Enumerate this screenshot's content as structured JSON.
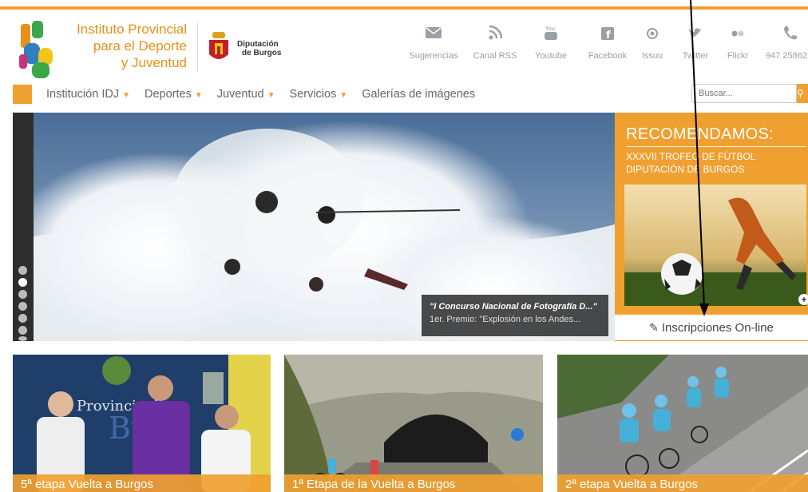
{
  "colors": {
    "accent": "#f0a030",
    "nav_text": "#666666",
    "social_icon": "#9aa0a8"
  },
  "header": {
    "idj_logo_lines": [
      "Instituto Provincial",
      "para el Deporte",
      "y Juventud"
    ],
    "diputacion_lines": [
      "Diputación",
      "de Burgos"
    ]
  },
  "social": [
    {
      "icon": "mail-icon",
      "label": "Sugerencias"
    },
    {
      "icon": "rss-icon",
      "label": "Canal RSS"
    },
    {
      "icon": "youtube-icon",
      "label": "Youtube"
    },
    {
      "icon": "facebook-icon",
      "label": "Facebook"
    },
    {
      "icon": "issuu-icon",
      "label": "Issuu"
    },
    {
      "icon": "twitter-icon",
      "label": "Twitter"
    },
    {
      "icon": "flickr-icon",
      "label": "Flickr"
    },
    {
      "icon": "phone-icon",
      "label": "947 25862"
    }
  ],
  "nav": [
    {
      "label": "Institución IDJ",
      "dropdown": true
    },
    {
      "label": "Deportes",
      "dropdown": true
    },
    {
      "label": "Juventud",
      "dropdown": true
    },
    {
      "label": "Servicios",
      "dropdown": true
    },
    {
      "label": "Galerías de imágenes",
      "dropdown": false
    }
  ],
  "search": {
    "placeholder": "Buscar..."
  },
  "slider": {
    "caption_title": "\"I Concurso Nacional de Fotografía D...\"",
    "caption_sub": "1er. Premio: \"Explosión en los Andes...",
    "dots": 7,
    "active_dot": 1
  },
  "recommend": {
    "title": "RECOMENDAMOS:",
    "subtitle_lines": [
      "XXXVII TROFEO DE FÚTBOL",
      "DIPUTACIÓN DE BURGOS"
    ],
    "button": "Inscripciones On-line"
  },
  "news": [
    {
      "title": "5ª etapa Vuelta a Burgos"
    },
    {
      "title": "1ª Etapa de la Vuelta a Burgos"
    },
    {
      "title": "2ª etapa Vuelta a Burgos"
    }
  ]
}
